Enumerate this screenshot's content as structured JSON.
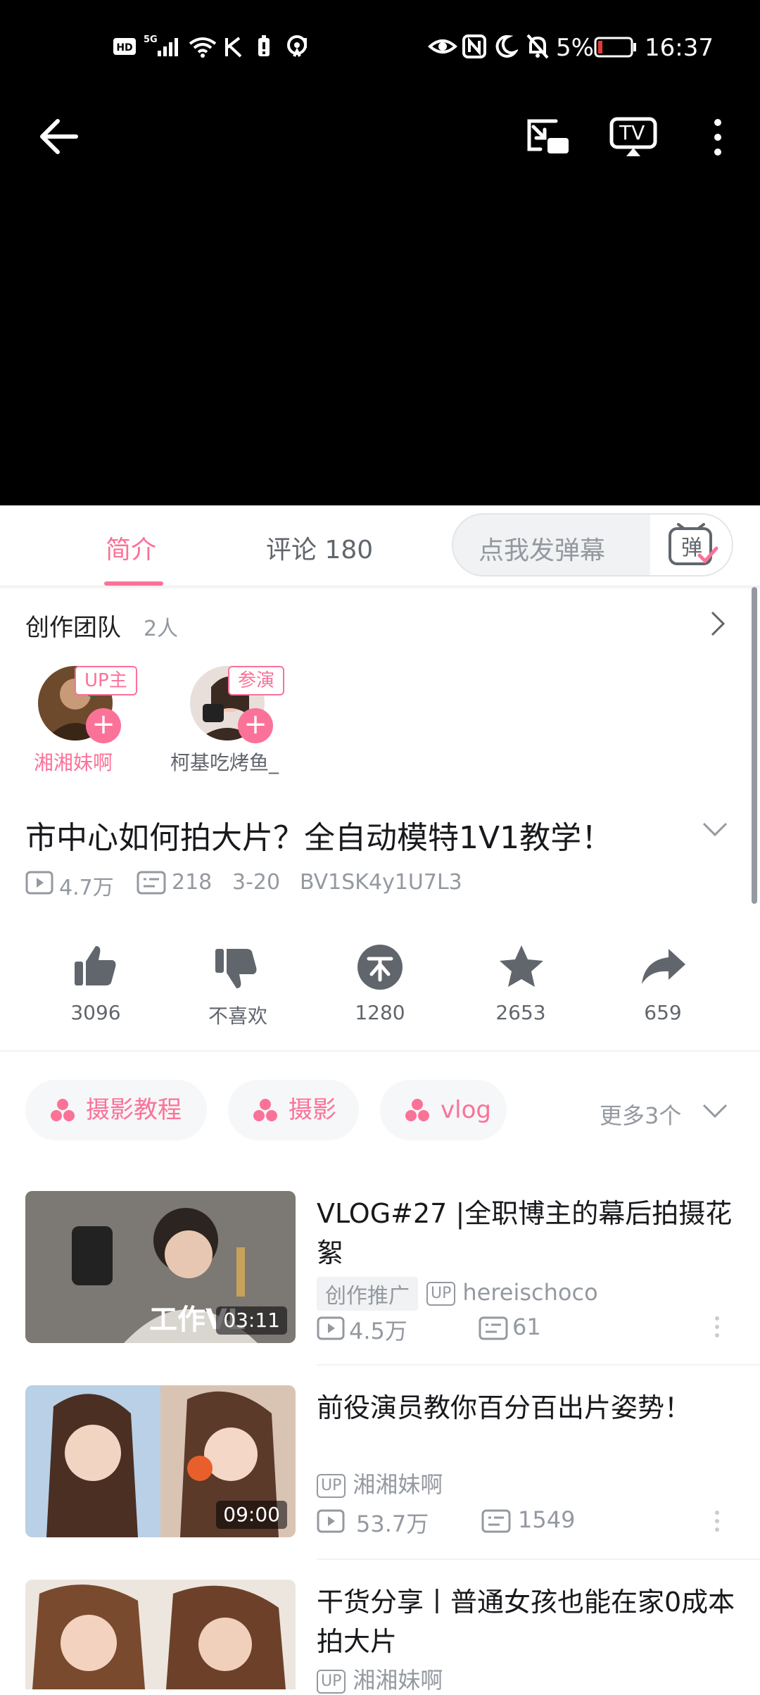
{
  "status_bar": {
    "network_icons": [
      "hd-icon",
      "5g-signal-icon",
      "wifi-icon",
      "k-icon",
      "battery-saver-icon",
      "hotspot-icon"
    ],
    "right_icons": [
      "eye-icon",
      "nfc-icon",
      "moon-icon",
      "mute-icon"
    ],
    "battery_percent": "5%",
    "time": "16:37"
  },
  "player": {
    "back": "back-arrow-icon",
    "pip": "picture-in-picture-icon",
    "cast": "TV",
    "menu": "more-vertical-icon"
  },
  "tabs": {
    "intro": "简介",
    "comments": "评论 180",
    "danmu_placeholder": "点我发弹幕",
    "danmu_button": "弹"
  },
  "team": {
    "title": "创作团队",
    "count": "2人",
    "members": [
      {
        "name": "湘湘妹啊",
        "badge": "UP主"
      },
      {
        "name": "柯基吃烤鱼_",
        "badge": "参演"
      }
    ]
  },
  "video": {
    "title": "市中心如何拍大片？全自动模特1V1教学！",
    "views": "4.7万",
    "danmaku": "218",
    "date": "3-20",
    "bvid": "BV1SK4y1U7L3"
  },
  "actions": {
    "like": "3096",
    "dislike": "不喜欢",
    "coin": "1280",
    "favorite": "2653",
    "share": "659"
  },
  "tags": {
    "items": [
      "摄影教程",
      "摄影",
      "vlog"
    ],
    "more": "更多3个"
  },
  "related": [
    {
      "title": "VLOG#27 |全职博主的幕后拍摄花絮",
      "promo": "创作推广",
      "up": "hereischoco",
      "views": "4.5万",
      "danmaku": "61",
      "duration": "03:11",
      "thumb_text": "工作VL"
    },
    {
      "title": "前役演员教你百分百出片姿势！",
      "up": "湘湘妹啊",
      "views": "53.7万",
      "danmaku": "1549",
      "duration": "09:00"
    },
    {
      "title": "干货分享丨普通女孩也能在家0成本拍大片",
      "up": "湘湘妹啊"
    }
  ],
  "colors": {
    "accent": "#fb7299",
    "muted": "#9499a0"
  }
}
